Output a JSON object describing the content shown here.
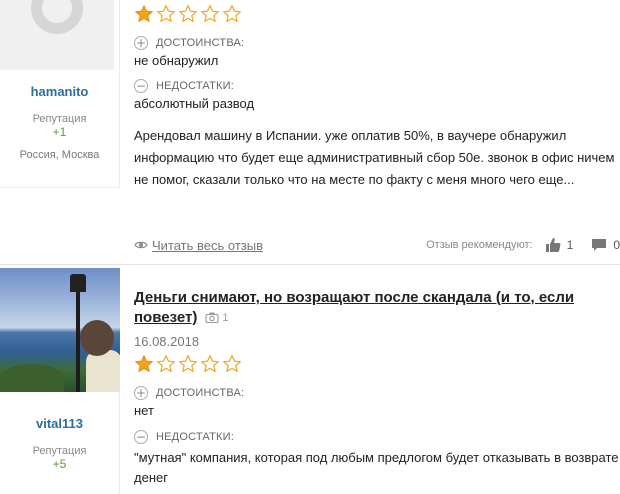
{
  "reviews": [
    {
      "author": {
        "name": "hamanito",
        "reputation_label": "Репутация",
        "reputation_value": "+1",
        "location": "Россия, Москва",
        "avatar": "default-avatar-icon"
      },
      "rating": 1,
      "pros_label": "ДОСТОИНСТВА:",
      "pros_text": "не обнаружил",
      "cons_label": "НЕДОСТАТКИ:",
      "cons_text": "абсолютный развод",
      "text": "Арендовал машину в Испании. уже оплатив 50%, в ваучере обнаружил информацию что будет еще административный сбор 50е. звонок в офис ничем не помог, сказали только что на месте по факту с меня много чего еще...",
      "read_more": "Читать весь отзыв",
      "recommend_label": "Отзыв рекомендуют:",
      "likes": "1",
      "comments": "0"
    },
    {
      "author": {
        "name": "vital113",
        "reputation_label": "Репутация",
        "reputation_value": "+5"
      },
      "title": "Деньги снимают, но возращают после скандала (и то, если повезет)",
      "photo_count": "1",
      "date": "16.08.2018",
      "rating": 1,
      "pros_label": "ДОСТОИНСТВА:",
      "pros_text": "нет",
      "cons_label": "НЕДОСТАТКИ:",
      "cons_text": "\"мутная\" компания, которая под любым предлогом будет отказывать в возврате денег"
    }
  ],
  "colors": {
    "star_fill": "#f2a31c",
    "star_outline": "#f2a31c",
    "author_link": "#2a6f9c",
    "rep_positive": "#5a9a3a"
  },
  "icons": [
    "star-icon",
    "plus-circle-icon",
    "minus-circle-icon",
    "eye-icon",
    "thumbs-up-icon",
    "comment-icon",
    "camera-icon"
  ]
}
